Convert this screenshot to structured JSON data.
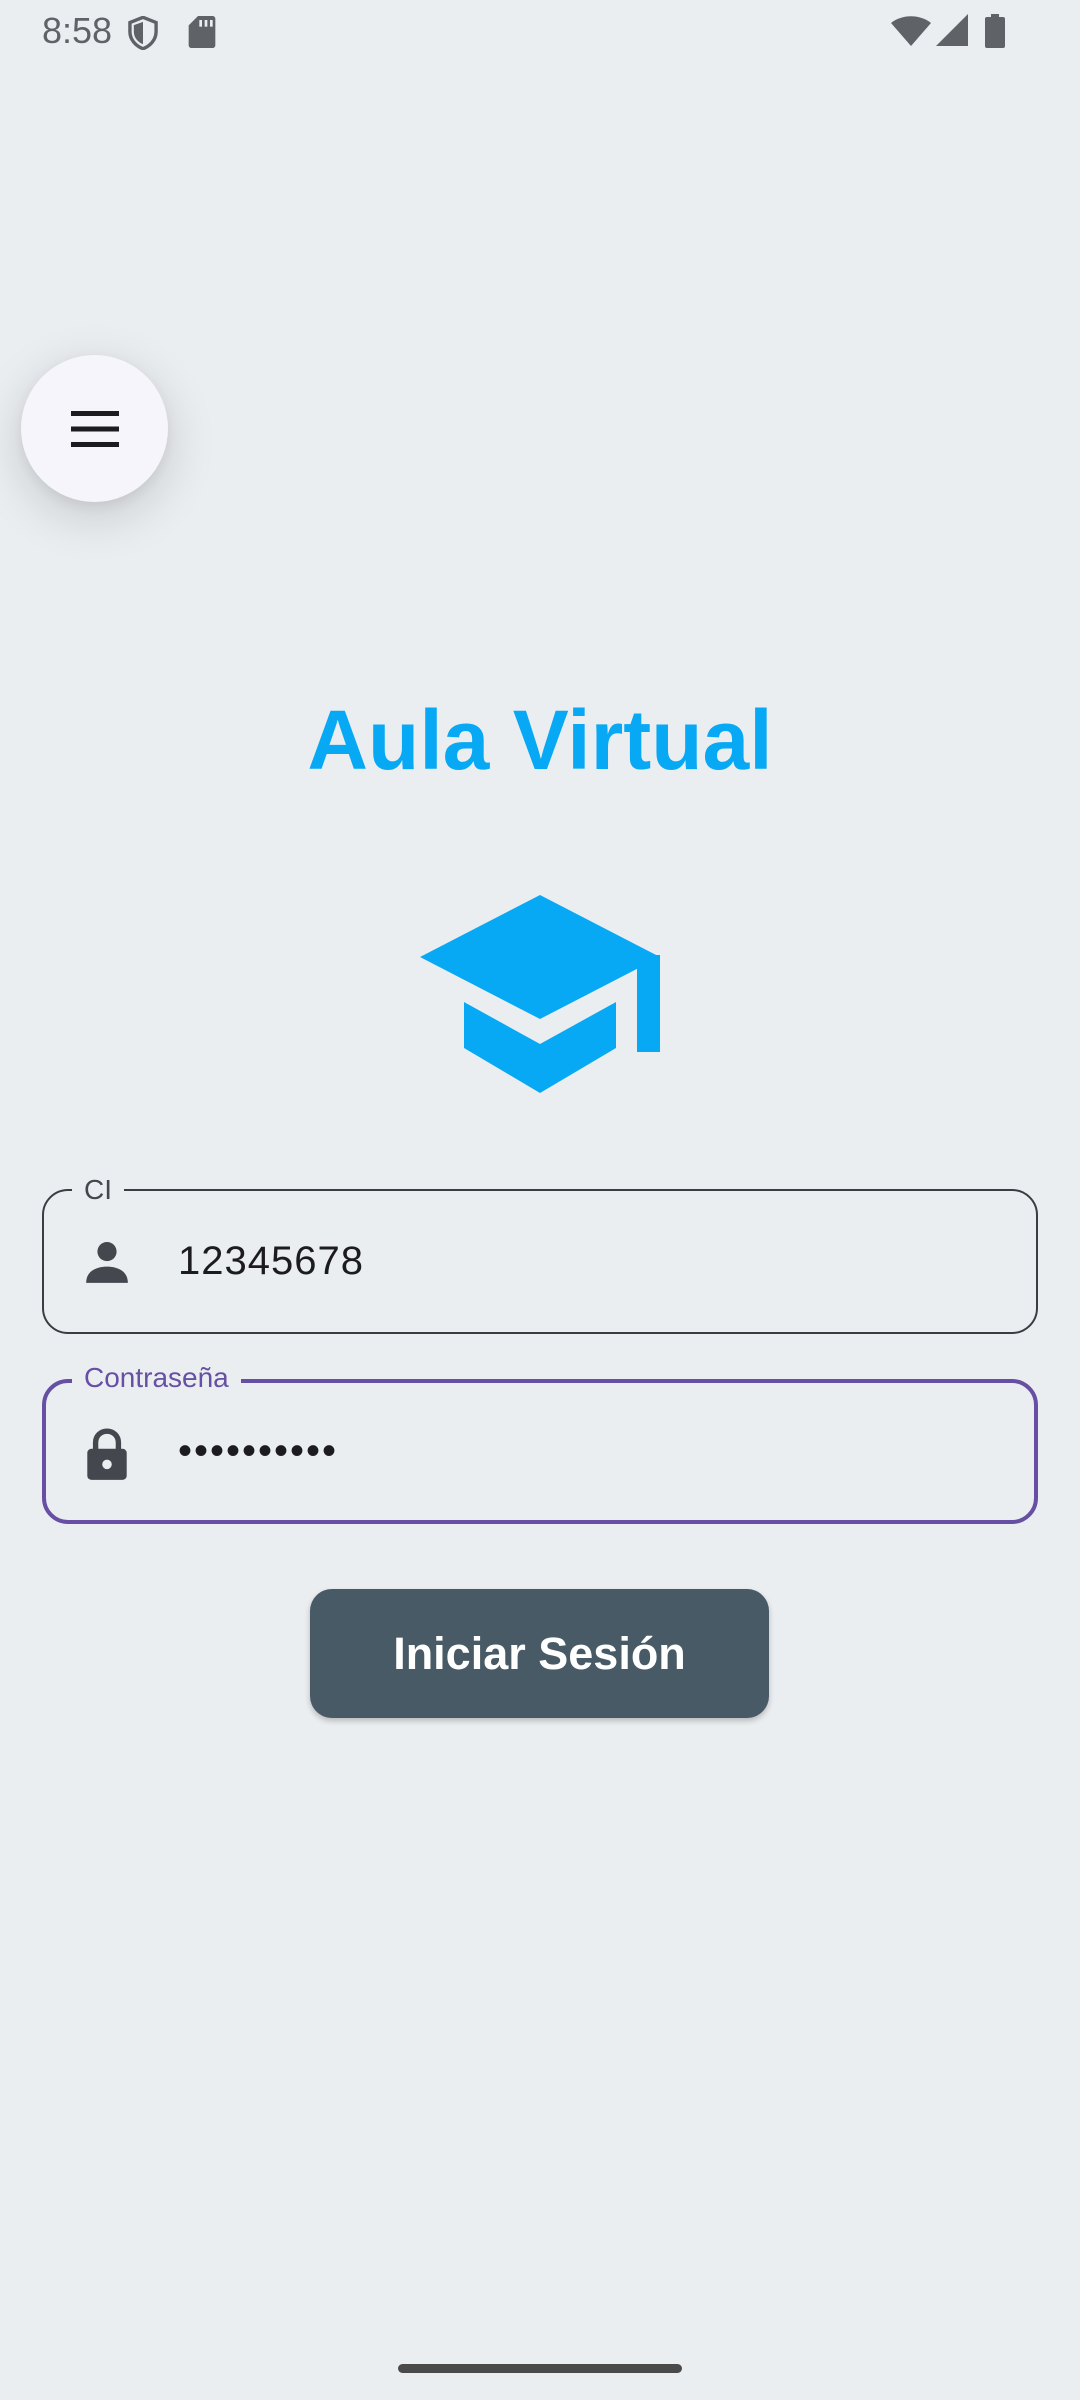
{
  "status_bar": {
    "time": "8:58",
    "left_icons": [
      "shield-icon",
      "sd-card-icon"
    ],
    "right_icons": [
      "wifi-icon",
      "cellular-signal-icon",
      "battery-icon"
    ]
  },
  "menu": {
    "icon": "hamburger-menu-icon"
  },
  "app": {
    "title": "Aula Virtual",
    "logo_icon": "graduation-cap-icon",
    "accent_color": "#08a9f4"
  },
  "form": {
    "ci": {
      "label": "CI",
      "value": "12345678",
      "icon": "person-icon"
    },
    "password": {
      "label": "Contraseña",
      "value": "••••••••••",
      "icon": "lock-icon",
      "focused": true,
      "focus_color": "#6750a4"
    },
    "submit_label": "Iniciar Sesión",
    "submit_color": "#475a66"
  }
}
